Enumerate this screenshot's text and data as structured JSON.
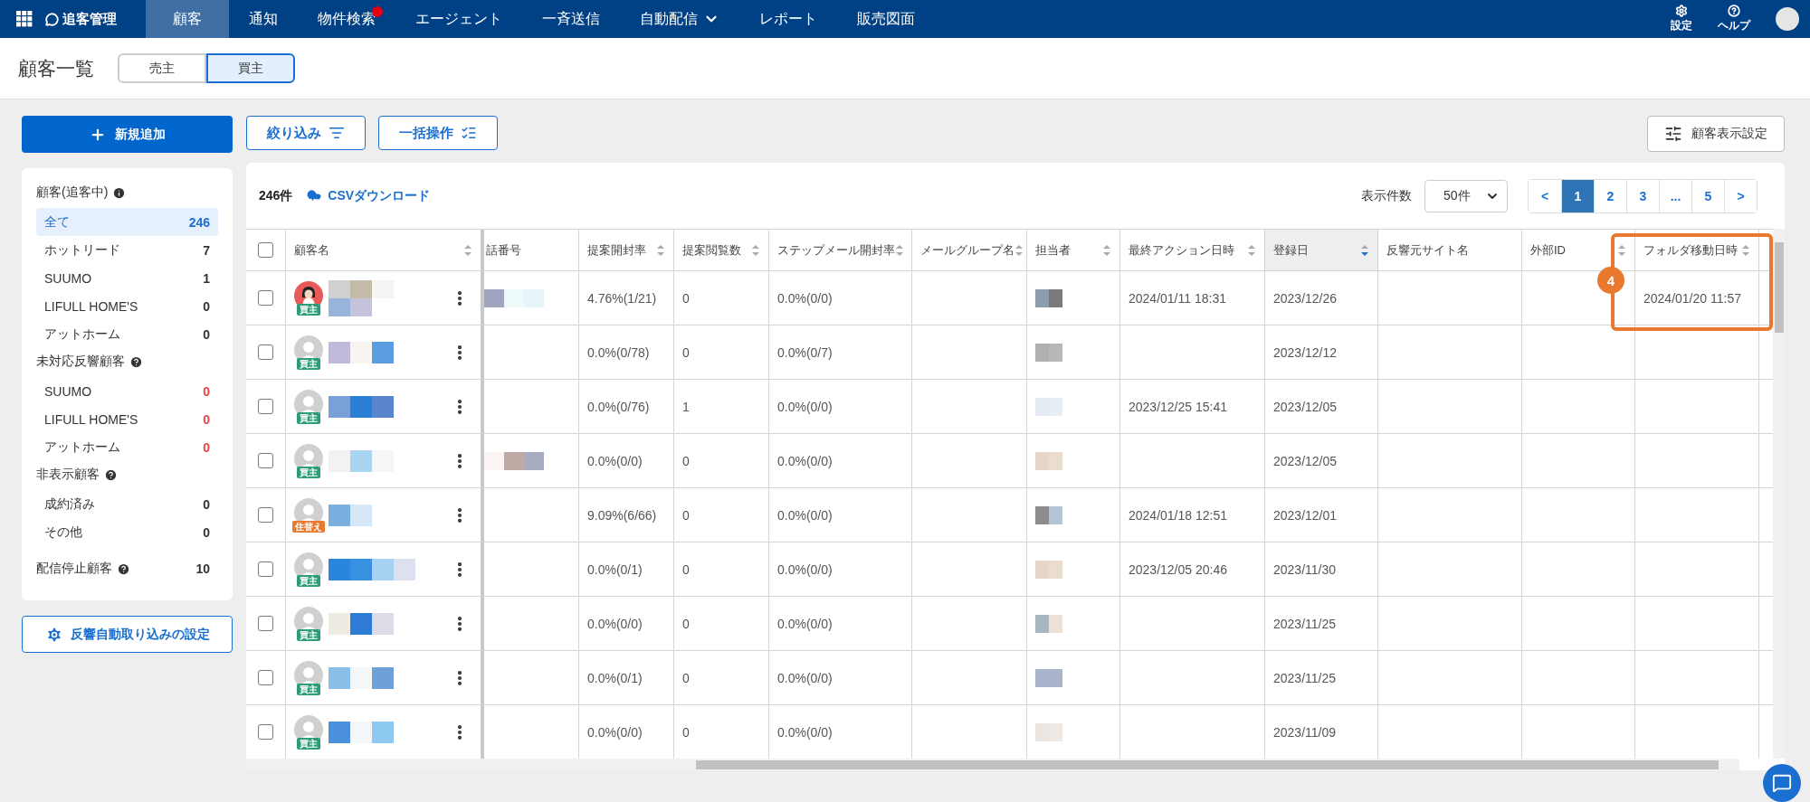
{
  "nav": {
    "logo": "追客管理",
    "tabs": [
      {
        "label": "顧客",
        "selected": true,
        "badge": false,
        "dropdown": false
      },
      {
        "label": "通知",
        "selected": false,
        "badge": false,
        "dropdown": false
      },
      {
        "label": "物件検索",
        "selected": false,
        "badge": true,
        "dropdown": false
      },
      {
        "label": "エージェント",
        "selected": false,
        "badge": false,
        "dropdown": false
      },
      {
        "label": "一斉送信",
        "selected": false,
        "badge": false,
        "dropdown": false
      },
      {
        "label": "自動配信",
        "selected": false,
        "badge": false,
        "dropdown": true
      },
      {
        "label": "レポート",
        "selected": false,
        "badge": false,
        "dropdown": false
      },
      {
        "label": "販売図面",
        "selected": false,
        "badge": false,
        "dropdown": false
      }
    ],
    "settings": "設定",
    "help": "ヘルプ"
  },
  "page": {
    "title": "顧客一覧",
    "segments": [
      {
        "label": "売主",
        "selected": false
      },
      {
        "label": "買主",
        "selected": true
      }
    ]
  },
  "toolbar": {
    "add": "新規追加",
    "filter": "絞り込み",
    "bulk": "一括操作",
    "display_settings": "顧客表示設定"
  },
  "sidebar": {
    "groups": [
      {
        "title": "顧客(追客中)",
        "kind": "info",
        "items": [
          {
            "label": "全て",
            "count": "246",
            "selected": true,
            "alert": false
          },
          {
            "label": "ホットリード",
            "count": "7",
            "selected": false,
            "alert": false
          },
          {
            "label": "SUUMO",
            "count": "1",
            "selected": false,
            "alert": false
          },
          {
            "label": "LIFULL HOME'S",
            "count": "0",
            "selected": false,
            "alert": false
          },
          {
            "label": "アットホーム",
            "count": "0",
            "selected": false,
            "alert": false
          }
        ]
      },
      {
        "title": "未対応反響顧客",
        "kind": "help",
        "items": [
          {
            "label": "SUUMO",
            "count": "0",
            "selected": false,
            "alert": true
          },
          {
            "label": "LIFULL HOME'S",
            "count": "0",
            "selected": false,
            "alert": true
          },
          {
            "label": "アットホーム",
            "count": "0",
            "selected": false,
            "alert": true
          }
        ]
      },
      {
        "title": "非表示顧客",
        "kind": "help",
        "items": [
          {
            "label": "成約済み",
            "count": "0",
            "selected": false,
            "alert": false
          },
          {
            "label": "その他",
            "count": "0",
            "selected": false,
            "alert": false
          }
        ]
      },
      {
        "title": "配信停止顧客",
        "kind": "help",
        "count": "10"
      }
    ],
    "auto_import": "反響自動取り込みの設定"
  },
  "table": {
    "total": "246件",
    "csv": "CSVダウンロード",
    "page_size_label": "表示件数",
    "page_size": "50件",
    "pages": [
      {
        "label": "<",
        "selected": false
      },
      {
        "label": "1",
        "selected": true
      },
      {
        "label": "2",
        "selected": false
      },
      {
        "label": "3",
        "selected": false
      },
      {
        "label": "...",
        "selected": false
      },
      {
        "label": "5",
        "selected": false
      },
      {
        "label": ">",
        "selected": false
      }
    ],
    "select_all_checked": false,
    "columns": [
      {
        "label": "顧客名",
        "sortable": true,
        "sorted": false
      },
      {
        "label": "話番号",
        "sortable": false,
        "sorted": false
      },
      {
        "label": "提案開封率",
        "sortable": true,
        "sorted": false
      },
      {
        "label": "提案閲覧数",
        "sortable": true,
        "sorted": false
      },
      {
        "label": "ステップメール開封率",
        "sortable": true,
        "sorted": false
      },
      {
        "label": "メールグループ名",
        "sortable": true,
        "sorted": false
      },
      {
        "label": "担当者",
        "sortable": true,
        "sorted": false
      },
      {
        "label": "最終アクション日時",
        "sortable": true,
        "sorted": false
      },
      {
        "label": "登録日",
        "sortable": true,
        "sorted": true
      },
      {
        "label": "反響元サイト名",
        "sortable": false,
        "sorted": false
      },
      {
        "label": "外部ID",
        "sortable": true,
        "sorted": false
      },
      {
        "label": "フォルダ移動日時",
        "sortable": true,
        "sorted": false
      }
    ],
    "rows": [
      {
        "checked": false,
        "avatar": {
          "kind": "photo"
        },
        "tag": {
          "label": "買主",
          "kind": "buyer"
        },
        "phone_masked": true,
        "open_rate": "4.76%(1/21)",
        "views": "0",
        "step_rate": "0.0%(0/0)",
        "last_action": "2024/01/11 18:31",
        "registered": "2023/12/26",
        "folder_moved": "2024/01/20 11:57"
      },
      {
        "checked": false,
        "avatar": {
          "kind": "default"
        },
        "tag": {
          "label": "買主",
          "kind": "buyer"
        },
        "phone_masked": false,
        "open_rate": "0.0%(0/78)",
        "views": "0",
        "step_rate": "0.0%(0/7)",
        "registered": "2023/12/12"
      },
      {
        "checked": false,
        "avatar": {
          "kind": "default"
        },
        "tag": {
          "label": "買主",
          "kind": "buyer"
        },
        "phone_masked": false,
        "open_rate": "0.0%(0/76)",
        "views": "1",
        "step_rate": "0.0%(0/0)",
        "last_action": "2023/12/25 15:41",
        "registered": "2023/12/05"
      },
      {
        "checked": false,
        "avatar": {
          "kind": "default"
        },
        "tag": {
          "label": "買主",
          "kind": "buyer"
        },
        "phone_masked": true,
        "open_rate": "0.0%(0/0)",
        "views": "0",
        "step_rate": "0.0%(0/0)",
        "registered": "2023/12/05"
      },
      {
        "checked": false,
        "avatar": {
          "kind": "default"
        },
        "tag": {
          "label": "住替え",
          "kind": "move"
        },
        "phone_masked": false,
        "open_rate": "9.09%(6/66)",
        "views": "0",
        "step_rate": "0.0%(0/0)",
        "last_action": "2024/01/18 12:51",
        "registered": "2023/12/01"
      },
      {
        "checked": false,
        "avatar": {
          "kind": "default"
        },
        "tag": {
          "label": "買主",
          "kind": "buyer"
        },
        "phone_masked": false,
        "open_rate": "0.0%(0/1)",
        "views": "0",
        "step_rate": "0.0%(0/0)",
        "last_action": "2023/12/05 20:46",
        "registered": "2023/11/30"
      },
      {
        "checked": false,
        "avatar": {
          "kind": "default"
        },
        "tag": {
          "label": "買主",
          "kind": "buyer"
        },
        "phone_masked": false,
        "open_rate": "0.0%(0/0)",
        "views": "0",
        "step_rate": "0.0%(0/0)",
        "registered": "2023/11/25"
      },
      {
        "checked": false,
        "avatar": {
          "kind": "default"
        },
        "tag": {
          "label": "買主",
          "kind": "buyer"
        },
        "phone_masked": false,
        "open_rate": "0.0%(0/1)",
        "views": "0",
        "step_rate": "0.0%(0/0)",
        "registered": "2023/11/25"
      },
      {
        "checked": false,
        "avatar": {
          "kind": "default"
        },
        "tag": {
          "label": "買主",
          "kind": "buyer"
        },
        "phone_masked": false,
        "open_rate": "0.0%(0/0)",
        "views": "0",
        "step_rate": "0.0%(0/0)",
        "registered": "2023/11/09"
      }
    ]
  },
  "annotation": {
    "number": "4"
  }
}
